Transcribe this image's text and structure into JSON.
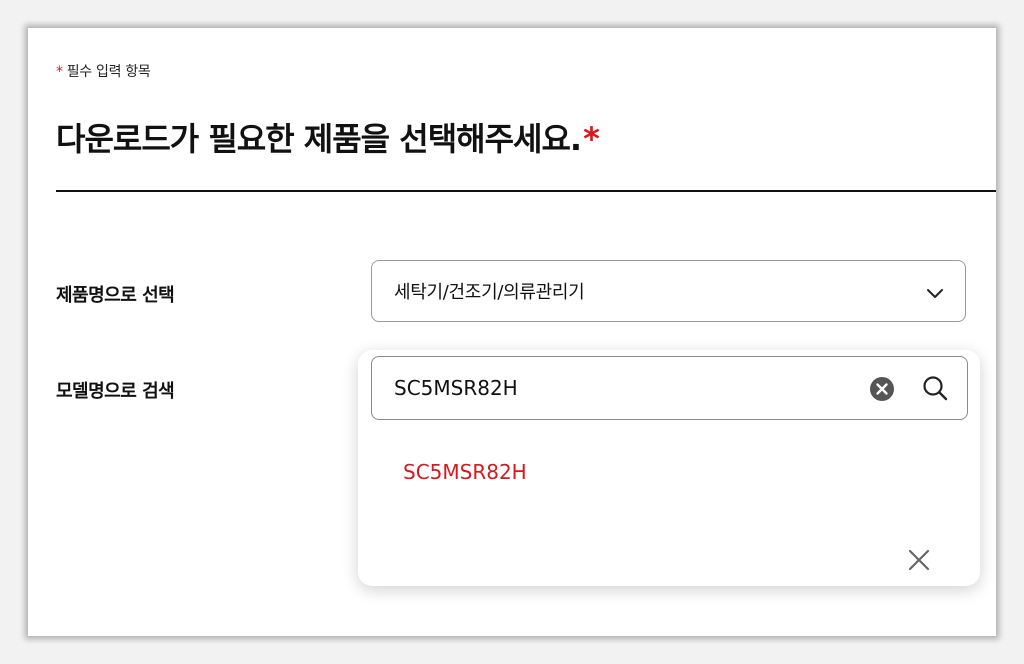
{
  "required_note": {
    "star": "*",
    "text": "필수 입력 항목"
  },
  "title": {
    "text": "다운로드가 필요한 제품을 선택해주세요.",
    "star": "*"
  },
  "product_select": {
    "label": "제품명으로 선택",
    "value": "세탁기/건조기/의류관리기",
    "icon": "chevron-down-icon"
  },
  "model_search": {
    "label": "모델명으로 검색",
    "value": "SC5MSR82H",
    "clear_icon": "clear-circle-icon",
    "search_icon": "search-icon"
  },
  "results": {
    "items": [
      "SC5MSR82H"
    ],
    "close_icon": "close-icon"
  },
  "colors": {
    "accent": "#d6181f",
    "text": "#111111",
    "border": "#9a9a9a"
  }
}
